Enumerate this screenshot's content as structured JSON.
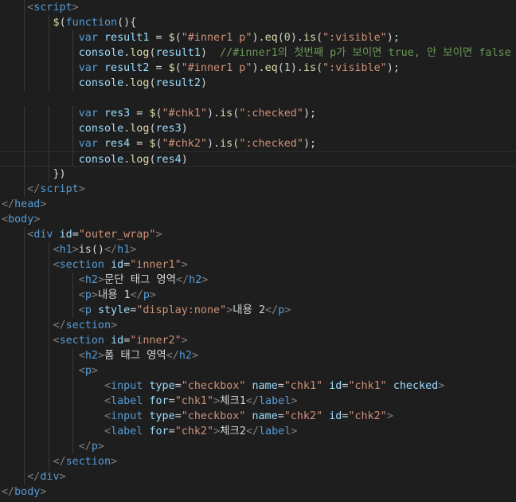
{
  "editor": {
    "theme": "dark",
    "colors": {
      "background": "#1e1e1e",
      "tag": "#569cd6",
      "punctuation": "#808080",
      "attribute": "#9cdcfe",
      "string": "#ce9178",
      "keyword": "#569cd6",
      "variable": "#9cdcfe",
      "function": "#dcdcaa",
      "number": "#b5cea8",
      "comment": "#6a9955",
      "text": "#d4d4d4"
    },
    "current_line": 10
  },
  "lines": [
    {
      "indent": 1,
      "tokens": [
        [
          "punc",
          "<"
        ],
        [
          "tag",
          "script"
        ],
        [
          "punc",
          ">"
        ]
      ]
    },
    {
      "indent": 2,
      "tokens": [
        [
          "fn",
          "$"
        ],
        [
          "text",
          "("
        ],
        [
          "kw",
          "function"
        ],
        [
          "text",
          "(){"
        ]
      ]
    },
    {
      "indent": 3,
      "tokens": [
        [
          "kw",
          "var"
        ],
        [
          "text",
          " "
        ],
        [
          "var",
          "result1"
        ],
        [
          "text",
          " = "
        ],
        [
          "fn",
          "$"
        ],
        [
          "text",
          "("
        ],
        [
          "str",
          "\"#inner1 p\""
        ],
        [
          "text",
          ")."
        ],
        [
          "fn",
          "eq"
        ],
        [
          "text",
          "("
        ],
        [
          "num",
          "0"
        ],
        [
          "text",
          ")."
        ],
        [
          "fn",
          "is"
        ],
        [
          "text",
          "("
        ],
        [
          "str",
          "\":visible\""
        ],
        [
          "text",
          ");"
        ]
      ]
    },
    {
      "indent": 3,
      "tokens": [
        [
          "var",
          "console"
        ],
        [
          "text",
          "."
        ],
        [
          "fn",
          "log"
        ],
        [
          "text",
          "("
        ],
        [
          "var",
          "result1"
        ],
        [
          "text",
          ")  "
        ],
        [
          "com",
          "//#inner1의 첫번째 p가 보이면 true, 안 보이면 false"
        ]
      ]
    },
    {
      "indent": 3,
      "tokens": [
        [
          "kw",
          "var"
        ],
        [
          "text",
          " "
        ],
        [
          "var",
          "result2"
        ],
        [
          "text",
          " = "
        ],
        [
          "fn",
          "$"
        ],
        [
          "text",
          "("
        ],
        [
          "str",
          "\"#inner1 p\""
        ],
        [
          "text",
          ")."
        ],
        [
          "fn",
          "eq"
        ],
        [
          "text",
          "("
        ],
        [
          "num",
          "1"
        ],
        [
          "text",
          ")."
        ],
        [
          "fn",
          "is"
        ],
        [
          "text",
          "("
        ],
        [
          "str",
          "\":visible\""
        ],
        [
          "text",
          ");"
        ]
      ]
    },
    {
      "indent": 3,
      "tokens": [
        [
          "var",
          "console"
        ],
        [
          "text",
          "."
        ],
        [
          "fn",
          "log"
        ],
        [
          "text",
          "("
        ],
        [
          "var",
          "result2"
        ],
        [
          "text",
          ")"
        ]
      ]
    },
    {
      "indent": 0,
      "tokens": []
    },
    {
      "indent": 3,
      "tokens": [
        [
          "kw",
          "var"
        ],
        [
          "text",
          " "
        ],
        [
          "var",
          "res3"
        ],
        [
          "text",
          " = "
        ],
        [
          "fn",
          "$"
        ],
        [
          "text",
          "("
        ],
        [
          "str",
          "\"#chk1\""
        ],
        [
          "text",
          ")."
        ],
        [
          "fn",
          "is"
        ],
        [
          "text",
          "("
        ],
        [
          "str",
          "\":checked\""
        ],
        [
          "text",
          ");"
        ]
      ]
    },
    {
      "indent": 3,
      "tokens": [
        [
          "var",
          "console"
        ],
        [
          "text",
          "."
        ],
        [
          "fn",
          "log"
        ],
        [
          "text",
          "("
        ],
        [
          "var",
          "res3"
        ],
        [
          "text",
          ")"
        ]
      ]
    },
    {
      "indent": 3,
      "tokens": [
        [
          "kw",
          "var"
        ],
        [
          "text",
          " "
        ],
        [
          "var",
          "res4"
        ],
        [
          "text",
          " = "
        ],
        [
          "fn",
          "$"
        ],
        [
          "text",
          "("
        ],
        [
          "str",
          "\"#chk2\""
        ],
        [
          "text",
          ")."
        ],
        [
          "fn",
          "is"
        ],
        [
          "text",
          "("
        ],
        [
          "str",
          "\":checked\""
        ],
        [
          "text",
          ");"
        ]
      ]
    },
    {
      "indent": 3,
      "tokens": [
        [
          "var",
          "console"
        ],
        [
          "text",
          "."
        ],
        [
          "fn",
          "log"
        ],
        [
          "text",
          "("
        ],
        [
          "var",
          "res4"
        ],
        [
          "text",
          ")"
        ]
      ]
    },
    {
      "indent": 2,
      "tokens": [
        [
          "text",
          "})"
        ]
      ]
    },
    {
      "indent": 1,
      "tokens": [
        [
          "punc",
          "</"
        ],
        [
          "tag",
          "script"
        ],
        [
          "punc",
          ">"
        ]
      ]
    },
    {
      "indent": 0,
      "tokens": [
        [
          "punc",
          "</"
        ],
        [
          "tag",
          "head"
        ],
        [
          "punc",
          ">"
        ]
      ]
    },
    {
      "indent": 0,
      "tokens": [
        [
          "punc",
          "<"
        ],
        [
          "tag",
          "body"
        ],
        [
          "punc",
          ">"
        ]
      ]
    },
    {
      "indent": 1,
      "tokens": [
        [
          "punc",
          "<"
        ],
        [
          "tag",
          "div"
        ],
        [
          "text",
          " "
        ],
        [
          "attr",
          "id"
        ],
        [
          "text",
          "="
        ],
        [
          "str",
          "\"outer_wrap\""
        ],
        [
          "punc",
          ">"
        ]
      ]
    },
    {
      "indent": 2,
      "tokens": [
        [
          "punc",
          "<"
        ],
        [
          "tag",
          "h1"
        ],
        [
          "punc",
          ">"
        ],
        [
          "text",
          "is()"
        ],
        [
          "punc",
          "</"
        ],
        [
          "tag",
          "h1"
        ],
        [
          "punc",
          ">"
        ]
      ]
    },
    {
      "indent": 2,
      "tokens": [
        [
          "punc",
          "<"
        ],
        [
          "tag",
          "section"
        ],
        [
          "text",
          " "
        ],
        [
          "attr",
          "id"
        ],
        [
          "text",
          "="
        ],
        [
          "str",
          "\"inner1\""
        ],
        [
          "punc",
          ">"
        ]
      ]
    },
    {
      "indent": 3,
      "tokens": [
        [
          "punc",
          "<"
        ],
        [
          "tag",
          "h2"
        ],
        [
          "punc",
          ">"
        ],
        [
          "text",
          "문단 태그 영역"
        ],
        [
          "punc",
          "</"
        ],
        [
          "tag",
          "h2"
        ],
        [
          "punc",
          ">"
        ]
      ]
    },
    {
      "indent": 3,
      "tokens": [
        [
          "punc",
          "<"
        ],
        [
          "tag",
          "p"
        ],
        [
          "punc",
          ">"
        ],
        [
          "text",
          "내용 1"
        ],
        [
          "punc",
          "</"
        ],
        [
          "tag",
          "p"
        ],
        [
          "punc",
          ">"
        ]
      ]
    },
    {
      "indent": 3,
      "tokens": [
        [
          "punc",
          "<"
        ],
        [
          "tag",
          "p"
        ],
        [
          "text",
          " "
        ],
        [
          "attr",
          "style"
        ],
        [
          "text",
          "="
        ],
        [
          "str",
          "\"display:none\""
        ],
        [
          "punc",
          ">"
        ],
        [
          "text",
          "내용 2"
        ],
        [
          "punc",
          "</"
        ],
        [
          "tag",
          "p"
        ],
        [
          "punc",
          ">"
        ]
      ]
    },
    {
      "indent": 2,
      "tokens": [
        [
          "punc",
          "</"
        ],
        [
          "tag",
          "section"
        ],
        [
          "punc",
          ">"
        ]
      ]
    },
    {
      "indent": 2,
      "tokens": [
        [
          "punc",
          "<"
        ],
        [
          "tag",
          "section"
        ],
        [
          "text",
          " "
        ],
        [
          "attr",
          "id"
        ],
        [
          "text",
          "="
        ],
        [
          "str",
          "\"inner2\""
        ],
        [
          "punc",
          ">"
        ]
      ]
    },
    {
      "indent": 3,
      "tokens": [
        [
          "punc",
          "<"
        ],
        [
          "tag",
          "h2"
        ],
        [
          "punc",
          ">"
        ],
        [
          "text",
          "폼 태그 영역"
        ],
        [
          "punc",
          "</"
        ],
        [
          "tag",
          "h2"
        ],
        [
          "punc",
          ">"
        ]
      ]
    },
    {
      "indent": 3,
      "tokens": [
        [
          "punc",
          "<"
        ],
        [
          "tag",
          "p"
        ],
        [
          "punc",
          ">"
        ]
      ]
    },
    {
      "indent": 4,
      "tokens": [
        [
          "punc",
          "<"
        ],
        [
          "tag",
          "input"
        ],
        [
          "text",
          " "
        ],
        [
          "attr",
          "type"
        ],
        [
          "text",
          "="
        ],
        [
          "str",
          "\"checkbox\""
        ],
        [
          "text",
          " "
        ],
        [
          "attr",
          "name"
        ],
        [
          "text",
          "="
        ],
        [
          "str",
          "\"chk1\""
        ],
        [
          "text",
          " "
        ],
        [
          "attr",
          "id"
        ],
        [
          "text",
          "="
        ],
        [
          "str",
          "\"chk1\""
        ],
        [
          "text",
          " "
        ],
        [
          "attr",
          "checked"
        ],
        [
          "punc",
          ">"
        ]
      ]
    },
    {
      "indent": 4,
      "tokens": [
        [
          "punc",
          "<"
        ],
        [
          "tag",
          "label"
        ],
        [
          "text",
          " "
        ],
        [
          "attr",
          "for"
        ],
        [
          "text",
          "="
        ],
        [
          "str",
          "\"chk1\""
        ],
        [
          "punc",
          ">"
        ],
        [
          "text",
          "체크1"
        ],
        [
          "punc",
          "</"
        ],
        [
          "tag",
          "label"
        ],
        [
          "punc",
          ">"
        ]
      ]
    },
    {
      "indent": 4,
      "tokens": [
        [
          "punc",
          "<"
        ],
        [
          "tag",
          "input"
        ],
        [
          "text",
          " "
        ],
        [
          "attr",
          "type"
        ],
        [
          "text",
          "="
        ],
        [
          "str",
          "\"checkbox\""
        ],
        [
          "text",
          " "
        ],
        [
          "attr",
          "name"
        ],
        [
          "text",
          "="
        ],
        [
          "str",
          "\"chk2\""
        ],
        [
          "text",
          " "
        ],
        [
          "attr",
          "id"
        ],
        [
          "text",
          "="
        ],
        [
          "str",
          "\"chk2\""
        ],
        [
          "punc",
          ">"
        ]
      ]
    },
    {
      "indent": 4,
      "tokens": [
        [
          "punc",
          "<"
        ],
        [
          "tag",
          "label"
        ],
        [
          "text",
          " "
        ],
        [
          "attr",
          "for"
        ],
        [
          "text",
          "="
        ],
        [
          "str",
          "\"chk2\""
        ],
        [
          "punc",
          ">"
        ],
        [
          "text",
          "체크2"
        ],
        [
          "punc",
          "</"
        ],
        [
          "tag",
          "label"
        ],
        [
          "punc",
          ">"
        ]
      ]
    },
    {
      "indent": 3,
      "tokens": [
        [
          "punc",
          "</"
        ],
        [
          "tag",
          "p"
        ],
        [
          "punc",
          ">"
        ]
      ]
    },
    {
      "indent": 2,
      "tokens": [
        [
          "punc",
          "</"
        ],
        [
          "tag",
          "section"
        ],
        [
          "punc",
          ">"
        ]
      ]
    },
    {
      "indent": 1,
      "tokens": [
        [
          "punc",
          "</"
        ],
        [
          "tag",
          "div"
        ],
        [
          "punc",
          ">"
        ]
      ]
    },
    {
      "indent": 0,
      "tokens": [
        [
          "punc",
          "</"
        ],
        [
          "tag",
          "body"
        ],
        [
          "punc",
          ">"
        ]
      ]
    }
  ]
}
